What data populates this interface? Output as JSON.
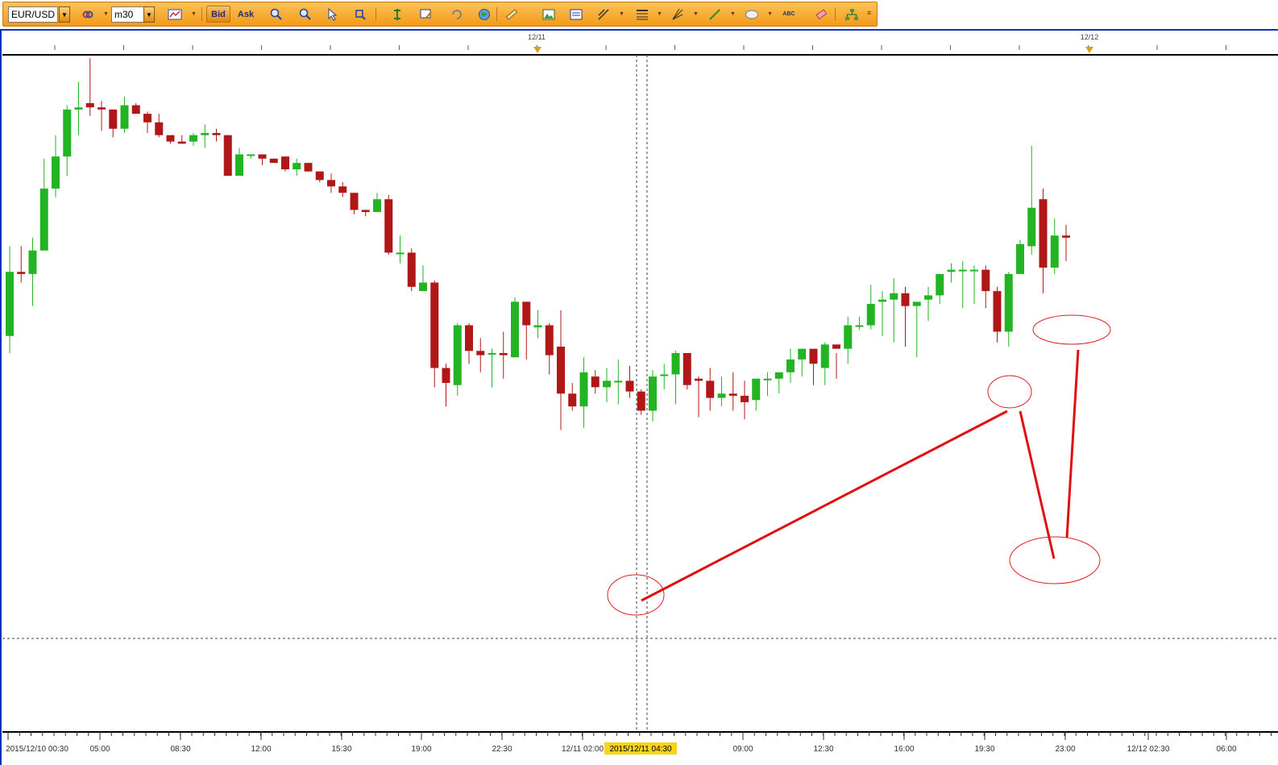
{
  "toolbar": {
    "symbol": "EUR/USD",
    "timeframe": "m30",
    "bid_label": "Bid",
    "ask_label": "Ask",
    "abc_label": "ABC",
    "icons": [
      "link-icon",
      "chart-type-icon",
      "zoom-in-icon",
      "zoom-out-icon",
      "cursor-icon",
      "crosshair-icon",
      "period-separator-icon",
      "comment-icon",
      "refresh-icon",
      "globe-icon",
      "ruler-icon",
      "screenshot-icon",
      "template-icon",
      "trendline-icon",
      "fibonacci-icon",
      "andrews-pitchfork-icon",
      "line-tool-icon",
      "ellipse-icon",
      "text-tool-icon",
      "eraser-icon",
      "hierarchy-icon"
    ],
    "accent_color": "#f5a623"
  },
  "top_axis": {
    "date_labels": [
      "12/11",
      "12/12"
    ]
  },
  "bottom_axis": {
    "labels": [
      "2015/12/10 00:30",
      "05:00",
      "08:30",
      "12:00",
      "15:30",
      "19:00",
      "22:30",
      "12/11 02:00",
      "09:00",
      "12:30",
      "16:00",
      "19:30",
      "23:00",
      "12/12 02:30",
      "06:00"
    ],
    "crosshair_time": "2015/12/11 04:30",
    "crosshair_time_bg": "#f7d31c"
  },
  "chart_data": {
    "type": "candlestick",
    "interval": "m30",
    "up_color": "#22b422",
    "down_color": "#b01818",
    "candles": [
      {
        "o": 0.5,
        "h": 4.7,
        "l": -0.3,
        "c": 3.5
      },
      {
        "o": 3.5,
        "h": 4.7,
        "l": 3.0,
        "c": 3.4
      },
      {
        "o": 3.4,
        "h": 5.1,
        "l": 1.9,
        "c": 4.5
      },
      {
        "o": 4.5,
        "h": 8.8,
        "l": 4.5,
        "c": 7.4
      },
      {
        "o": 7.4,
        "h": 9.9,
        "l": 7.0,
        "c": 8.9
      },
      {
        "o": 8.9,
        "h": 11.3,
        "l": 8.0,
        "c": 11.1
      },
      {
        "o": 11.1,
        "h": 12.4,
        "l": 9.9,
        "c": 11.2
      },
      {
        "o": 11.4,
        "h": 13.5,
        "l": 10.8,
        "c": 11.2
      },
      {
        "o": 11.2,
        "h": 11.5,
        "l": 10.1,
        "c": 11.1
      },
      {
        "o": 11.1,
        "h": 11.1,
        "l": 9.8,
        "c": 10.2
      },
      {
        "o": 10.2,
        "h": 11.7,
        "l": 10.0,
        "c": 11.3
      },
      {
        "o": 11.3,
        "h": 11.4,
        "l": 10.9,
        "c": 10.9
      },
      {
        "o": 10.9,
        "h": 11.0,
        "l": 10.0,
        "c": 10.5
      },
      {
        "o": 10.5,
        "h": 10.9,
        "l": 9.8,
        "c": 9.9
      },
      {
        "o": 9.9,
        "h": 9.9,
        "l": 9.5,
        "c": 9.6
      },
      {
        "o": 9.6,
        "h": 9.9,
        "l": 9.5,
        "c": 9.5
      },
      {
        "o": 9.6,
        "h": 10.0,
        "l": 9.4,
        "c": 9.9
      },
      {
        "o": 9.9,
        "h": 10.4,
        "l": 9.3,
        "c": 10.0
      },
      {
        "o": 10.0,
        "h": 10.2,
        "l": 9.6,
        "c": 9.9
      },
      {
        "o": 9.9,
        "h": 9.9,
        "l": 8.0,
        "c": 8.0
      },
      {
        "o": 8.0,
        "h": 9.3,
        "l": 8.0,
        "c": 9.0
      },
      {
        "o": 9.0,
        "h": 9.0,
        "l": 8.8,
        "c": 9.0
      },
      {
        "o": 9.0,
        "h": 9.0,
        "l": 8.5,
        "c": 8.8
      },
      {
        "o": 8.8,
        "h": 8.8,
        "l": 8.6,
        "c": 8.6
      },
      {
        "o": 8.9,
        "h": 8.9,
        "l": 8.2,
        "c": 8.3
      },
      {
        "o": 8.3,
        "h": 8.8,
        "l": 8.0,
        "c": 8.6
      },
      {
        "o": 8.6,
        "h": 8.6,
        "l": 8.2,
        "c": 8.2
      },
      {
        "o": 8.2,
        "h": 8.2,
        "l": 7.7,
        "c": 7.8
      },
      {
        "o": 7.8,
        "h": 8.1,
        "l": 7.2,
        "c": 7.5
      },
      {
        "o": 7.5,
        "h": 7.7,
        "l": 7.0,
        "c": 7.2
      },
      {
        "o": 7.2,
        "h": 7.2,
        "l": 6.2,
        "c": 6.4
      },
      {
        "o": 6.4,
        "h": 6.4,
        "l": 6.1,
        "c": 6.3
      },
      {
        "o": 6.3,
        "h": 7.2,
        "l": 6.3,
        "c": 6.9
      },
      {
        "o": 6.9,
        "h": 7.1,
        "l": 4.3,
        "c": 4.4
      },
      {
        "o": 4.4,
        "h": 5.2,
        "l": 3.9,
        "c": 4.4
      },
      {
        "o": 4.4,
        "h": 4.6,
        "l": 2.6,
        "c": 2.8
      },
      {
        "o": 2.6,
        "h": 3.8,
        "l": 2.6,
        "c": 3.0
      },
      {
        "o": 3.0,
        "h": 3.1,
        "l": -1.9,
        "c": -1.0
      },
      {
        "o": -1.0,
        "h": -0.8,
        "l": -2.8,
        "c": -1.7
      },
      {
        "o": -1.8,
        "h": 1.1,
        "l": -2.3,
        "c": 1.0
      },
      {
        "o": 1.0,
        "h": 1.1,
        "l": -0.8,
        "c": -0.2
      },
      {
        "o": -0.2,
        "h": 0.4,
        "l": -1.2,
        "c": -0.4
      },
      {
        "o": -0.3,
        "h": -0.1,
        "l": -1.9,
        "c": -0.3
      },
      {
        "o": -0.3,
        "h": 0.7,
        "l": -1.5,
        "c": -0.4
      },
      {
        "o": -0.5,
        "h": 2.3,
        "l": -0.5,
        "c": 2.1
      },
      {
        "o": 2.1,
        "h": 2.1,
        "l": -0.6,
        "c": 1.0
      },
      {
        "o": 0.9,
        "h": 1.7,
        "l": 0.4,
        "c": 1.0
      },
      {
        "o": 1.0,
        "h": 1.1,
        "l": -1.3,
        "c": -0.4
      },
      {
        "o": 0.0,
        "h": 1.7,
        "l": -3.9,
        "c": -2.2
      },
      {
        "o": -2.2,
        "h": -1.7,
        "l": -3.0,
        "c": -2.8
      },
      {
        "o": -2.8,
        "h": -0.5,
        "l": -3.8,
        "c": -1.2
      },
      {
        "o": -1.4,
        "h": -1.1,
        "l": -2.2,
        "c": -1.9
      },
      {
        "o": -1.9,
        "h": -1.0,
        "l": -2.6,
        "c": -1.6
      },
      {
        "o": -1.6,
        "h": -0.6,
        "l": -2.7,
        "c": -1.6
      },
      {
        "o": -1.6,
        "h": -0.9,
        "l": -2.4,
        "c": -2.1
      },
      {
        "o": -2.1,
        "h": -2.0,
        "l": -3.2,
        "c": -3.0
      },
      {
        "o": -3.0,
        "h": -1.1,
        "l": -3.5,
        "c": -1.4
      },
      {
        "o": -1.3,
        "h": -0.8,
        "l": -2.0,
        "c": -1.3
      },
      {
        "o": -1.3,
        "h": -0.2,
        "l": -2.7,
        "c": -0.3
      },
      {
        "o": -0.3,
        "h": -0.3,
        "l": -2.0,
        "c": -1.8
      },
      {
        "o": -1.5,
        "h": -1.4,
        "l": -3.3,
        "c": -1.6
      },
      {
        "o": -1.6,
        "h": -1.0,
        "l": -3.0,
        "c": -2.4
      },
      {
        "o": -2.4,
        "h": -1.4,
        "l": -2.8,
        "c": -2.2
      },
      {
        "o": -2.2,
        "h": -1.2,
        "l": -3.0,
        "c": -2.3
      },
      {
        "o": -2.3,
        "h": -1.6,
        "l": -3.4,
        "c": -2.6
      },
      {
        "o": -2.5,
        "h": -1.5,
        "l": -3.0,
        "c": -1.5
      },
      {
        "o": -1.5,
        "h": -1.2,
        "l": -2.3,
        "c": -1.5
      },
      {
        "o": -1.5,
        "h": -1.3,
        "l": -2.2,
        "c": -1.2
      },
      {
        "o": -1.2,
        "h": -0.1,
        "l": -1.7,
        "c": -0.6
      },
      {
        "o": -0.6,
        "h": -0.2,
        "l": -1.4,
        "c": -0.1
      },
      {
        "o": -0.1,
        "h": -0.3,
        "l": -1.8,
        "c": -0.8
      },
      {
        "o": -1.0,
        "h": 0.2,
        "l": -1.8,
        "c": 0.1
      },
      {
        "o": 0.1,
        "h": -0.3,
        "l": -1.5,
        "c": -0.1
      },
      {
        "o": -0.1,
        "h": 1.4,
        "l": -0.8,
        "c": 1.0
      },
      {
        "o": 1.0,
        "h": 1.4,
        "l": 0.8,
        "c": 1.0
      },
      {
        "o": 1.0,
        "h": 2.9,
        "l": 0.8,
        "c": 2.0
      },
      {
        "o": 2.1,
        "h": 2.6,
        "l": 0.5,
        "c": 2.2
      },
      {
        "o": 2.2,
        "h": 3.2,
        "l": 0.2,
        "c": 2.5
      },
      {
        "o": 2.5,
        "h": 2.8,
        "l": 0.0,
        "c": 1.9
      },
      {
        "o": 1.9,
        "h": 2.0,
        "l": -0.5,
        "c": 2.1
      },
      {
        "o": 2.2,
        "h": 2.8,
        "l": 1.2,
        "c": 2.4
      },
      {
        "o": 2.4,
        "h": 3.4,
        "l": 2.0,
        "c": 3.4
      },
      {
        "o": 3.5,
        "h": 3.9,
        "l": 3.0,
        "c": 3.6
      },
      {
        "o": 3.6,
        "h": 4.0,
        "l": 1.8,
        "c": 3.6
      },
      {
        "o": 3.6,
        "h": 3.8,
        "l": 2.0,
        "c": 3.6
      },
      {
        "o": 3.6,
        "h": 3.8,
        "l": 1.8,
        "c": 2.6
      },
      {
        "o": 2.6,
        "h": 2.8,
        "l": 0.2,
        "c": 0.7
      },
      {
        "o": 0.7,
        "h": 3.5,
        "l": 0.0,
        "c": 3.4
      },
      {
        "o": 3.4,
        "h": 5.0,
        "l": 3.4,
        "c": 4.8
      },
      {
        "o": 4.7,
        "h": 9.4,
        "l": 4.3,
        "c": 6.5
      },
      {
        "o": 6.9,
        "h": 7.4,
        "l": 2.5,
        "c": 3.7
      },
      {
        "o": 3.7,
        "h": 6.0,
        "l": 3.4,
        "c": 5.2
      },
      {
        "o": 5.2,
        "h": 5.7,
        "l": 4.0,
        "c": 5.1
      }
    ],
    "crosshair_price_line": true,
    "annotations": [
      "trendline",
      "ellipse",
      "ellipse",
      "ellipse",
      "ellipse"
    ]
  }
}
